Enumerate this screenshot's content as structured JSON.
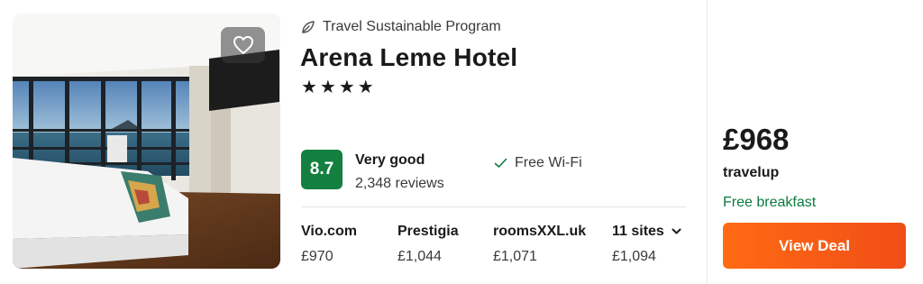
{
  "listing": {
    "sustainability_label": "Travel Sustainable Program",
    "name": "Arena Leme Hotel",
    "stars": "★★★★",
    "star_count": 4,
    "rating": {
      "score": "8.7",
      "label": "Very good",
      "reviews": "2,348 reviews",
      "color": "#13803f"
    },
    "amenity": "Free Wi-Fi",
    "icons": {
      "sustain": "leaf-icon",
      "favorite": "heart-icon",
      "amenity": "check-icon",
      "expand": "chevron-down-icon"
    }
  },
  "sites": [
    {
      "name": "Vio.com",
      "price": "£970"
    },
    {
      "name": "Prestigia",
      "price": "£1,044"
    },
    {
      "name": "roomsXXL.uk",
      "price": "£1,071"
    },
    {
      "name": "11 sites",
      "price": "£1,094"
    }
  ],
  "offer": {
    "price": "£968",
    "provider": "travelup",
    "perk": "Free breakfast",
    "button_label": "View Deal",
    "button_color": "#ff6a13"
  }
}
